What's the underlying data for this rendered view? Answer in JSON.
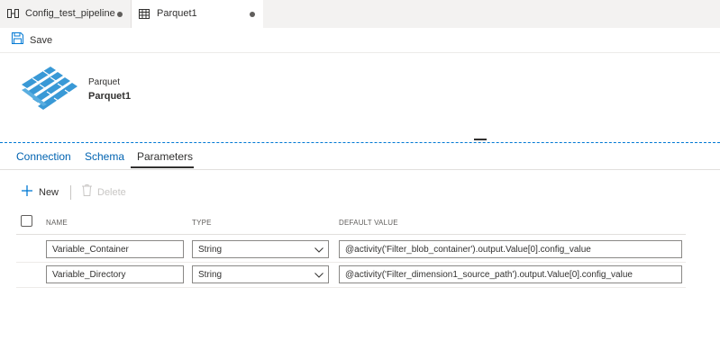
{
  "tabs": [
    {
      "label": "Config_test_pipeline",
      "icon": "pipeline-icon"
    },
    {
      "label": "Parquet1",
      "icon": "table-icon"
    }
  ],
  "toolbar": {
    "save_label": "Save"
  },
  "dataset": {
    "type": "Parquet",
    "name": "Parquet1"
  },
  "panel_tabs": [
    {
      "label": "Connection"
    },
    {
      "label": "Schema"
    },
    {
      "label": "Parameters"
    }
  ],
  "commands": {
    "new_label": "New",
    "delete_label": "Delete"
  },
  "table": {
    "headers": {
      "name": "NAME",
      "type": "TYPE",
      "default": "DEFAULT VALUE"
    },
    "rows": [
      {
        "name": "Variable_Container",
        "type": "String",
        "default": "@activity('Filter_blob_container').output.Value[0].config_value"
      },
      {
        "name": "Variable_Directory",
        "type": "String",
        "default": "@activity('Filter_dimension1_source_path').output.Value[0].config_value"
      }
    ]
  },
  "colors": {
    "accent": "#0078d4",
    "link": "#0063b1",
    "logo": "#3999d6"
  }
}
